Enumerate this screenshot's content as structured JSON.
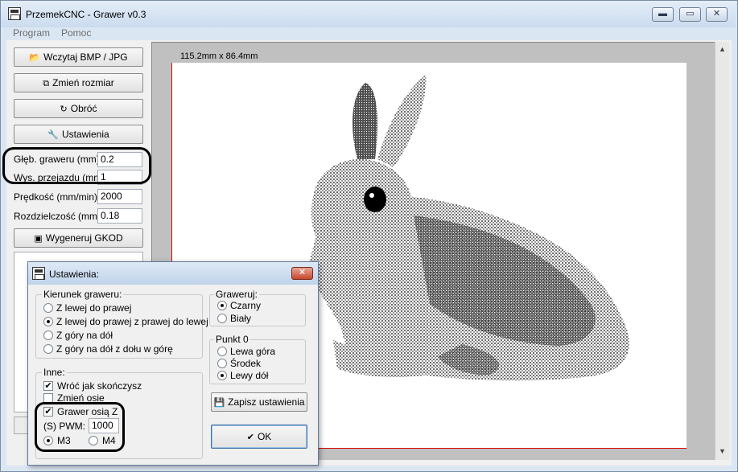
{
  "window": {
    "title": "PrzemekCNC - Grawer v0.3"
  },
  "window_controls": {
    "minimize": "▬",
    "maximize": "▭",
    "close": "✕"
  },
  "menu": {
    "items": [
      "Program",
      "Pomoc"
    ]
  },
  "toolbar": {
    "load_button": "Wczytaj BMP / JPG",
    "resize_button": "Zmień rozmiar",
    "rotate_button": "Obróć",
    "settings_button": "Ustawienia",
    "generate_button": "Wygeneruj GKOD"
  },
  "params": {
    "depth_label": "Głęb. graweru (mm):",
    "depth_value": "0.2",
    "lift_label": "Wys. przejazdu (mm):",
    "lift_value": "1",
    "speed_label": "Prędkość (mm/min):",
    "speed_value": "2000",
    "resolution_label": "Rozdzielczość (mm):",
    "resolution_value": "0.18"
  },
  "canvas": {
    "dimensions": "115.2mm x 86.4mm"
  },
  "dialog": {
    "title": "Ustawienia:",
    "direction": {
      "title": "Kierunek graweru:",
      "options": [
        "Z lewej do prawej",
        "Z lewej do prawej z prawej do lewej",
        "Z góry na dół",
        "Z góry na dół z dołu w górę"
      ],
      "selected_index": 1
    },
    "engrave": {
      "title": "Graweruj:",
      "options": [
        "Czarny",
        "Biały"
      ],
      "selected_index": 0
    },
    "origin": {
      "title": "Punkt 0",
      "options": [
        "Lewa góra",
        "Środek",
        "Lewy dół"
      ],
      "selected_index": 2
    },
    "other": {
      "title": "Inne:",
      "return_when_done": "Wróć jak skończysz",
      "return_when_done_checked": true,
      "swap_axes": "Zmień osie",
      "swap_axes_checked": false,
      "z_axis": "Grawer osią Z",
      "z_axis_checked": true,
      "pwm_label": "(S) PWM:",
      "pwm_value": "1000",
      "m3": "M3",
      "m4": "M4",
      "mode_selected": "M3"
    },
    "save_button": "Zapisz ustawienia",
    "ok_button": "OK"
  }
}
